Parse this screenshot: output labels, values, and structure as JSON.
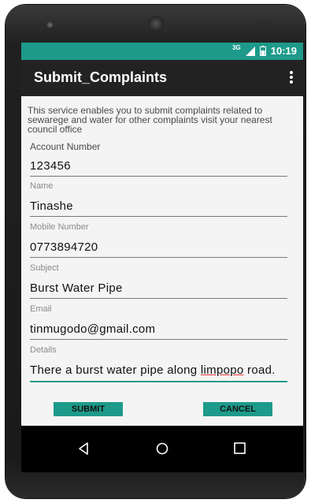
{
  "status_bar": {
    "network": "3G",
    "time": "10:19"
  },
  "app_bar": {
    "title": "Submit_Complaints",
    "menu_icon": "overflow-menu-icon"
  },
  "form": {
    "intro": "This service enables you to submit complaints related to sewarege and water for other complaints visit your nearest council office",
    "account_label": "Account Number",
    "account_value": "123456",
    "name_label": "Name",
    "name_value": "Tinashe",
    "mobile_label": "Mobile Number",
    "mobile_value": "0773894720",
    "subject_label": "Subject",
    "subject_value": "Burst Water Pipe",
    "email_label": "Email",
    "email_value": "tinmugodo@gmail.com",
    "details_label": "Details",
    "details_value_part1": "There a burst water pipe along ",
    "details_value_misspelled": "limpopo",
    "details_value_part2": " road."
  },
  "buttons": {
    "submit": "SUBMIT",
    "cancel": "CANCEL"
  },
  "nav": {
    "back_icon": "back-icon",
    "home_icon": "home-icon",
    "recents_icon": "recents-icon"
  },
  "colors": {
    "accent": "#1e9a8a",
    "appbar": "#222222",
    "form_bg": "#f4f4f4"
  }
}
